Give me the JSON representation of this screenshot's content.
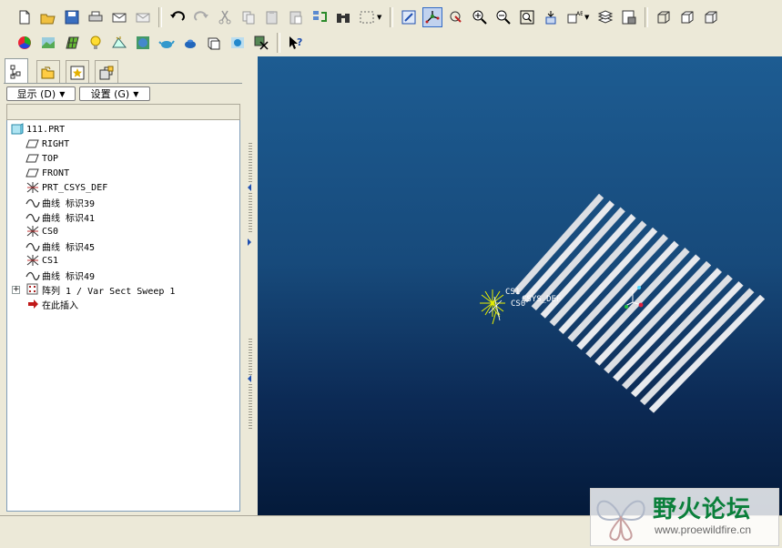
{
  "panel": {
    "display_menu_label": "显示 (D)",
    "settings_menu_label": "设置 (G)"
  },
  "tree": {
    "items": [
      {
        "label": "111.PRT",
        "icon": "part-icon"
      },
      {
        "label": "RIGHT",
        "icon": "datum-plane-icon"
      },
      {
        "label": "TOP",
        "icon": "datum-plane-icon"
      },
      {
        "label": "FRONT",
        "icon": "datum-plane-icon"
      },
      {
        "label": "PRT_CSYS_DEF",
        "icon": "csys-icon"
      },
      {
        "label": "曲线 标识39",
        "icon": "curve-icon"
      },
      {
        "label": "曲线 标识41",
        "icon": "curve-icon"
      },
      {
        "label": "CS0",
        "icon": "csys-icon"
      },
      {
        "label": "曲线 标识45",
        "icon": "curve-icon"
      },
      {
        "label": "CS1",
        "icon": "csys-icon"
      },
      {
        "label": "曲线 标识49",
        "icon": "curve-icon"
      },
      {
        "label": "阵列 1 / Var Sect Sweep 1",
        "icon": "pattern-icon"
      },
      {
        "label": "在此插入",
        "icon": "insert-here-arrow-icon"
      }
    ]
  },
  "viewport": {
    "labels": {
      "cs1": "CS1",
      "csys_def": "CSYS_DEF",
      "cs0": "CS0"
    }
  },
  "watermark": {
    "title": "野火论坛",
    "url": "www.proewildfire.cn"
  },
  "colors": {
    "viewport_top": "#1d5c92",
    "viewport_bottom": "#041a3a",
    "selection_blue": "#316ac5",
    "watermark_green": "#0a7f3a"
  }
}
